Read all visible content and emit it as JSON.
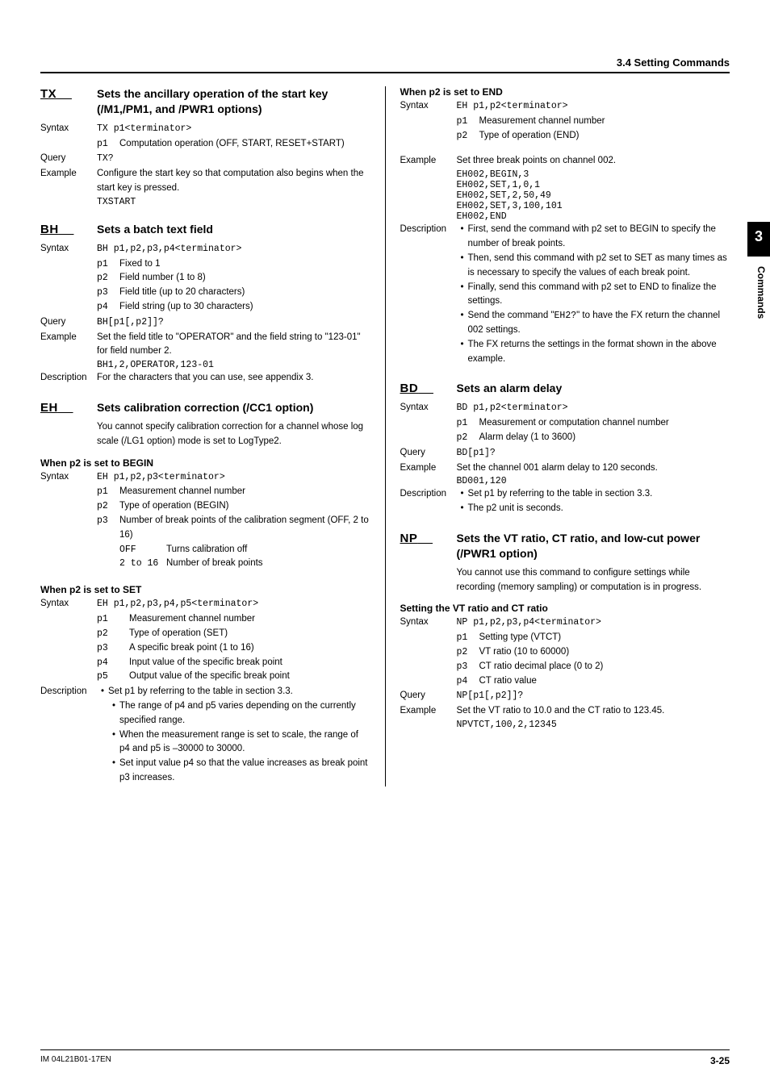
{
  "section_header": "3.4  Setting Commands",
  "side_tab": "3",
  "side_label": "Commands",
  "footer_left": "IM 04L21B01-17EN",
  "footer_right": "3-25",
  "left": {
    "tx": {
      "code": "TX",
      "title": "Sets the ancillary operation of the start key (/M1,/PM1, and /PWR1 options)",
      "syntax_label": "Syntax",
      "syntax": "TX p1<terminator>",
      "p1": "Computation operation (OFF, START, RESET+START)",
      "query_label": "Query",
      "query": "TX?",
      "example_label": "Example",
      "example_text": "Configure the start key so that computation also begins when the start key is pressed.",
      "example_code": "TXSTART"
    },
    "bh": {
      "code": "BH",
      "title": "Sets a batch text field",
      "syntax_label": "Syntax",
      "syntax": "BH p1,p2,p3,p4<terminator>",
      "p1": "Fixed to 1",
      "p2": "Field number (1 to 8)",
      "p3": "Field title (up to 20 characters)",
      "p4": "Field string (up to 30 characters)",
      "query_label": "Query",
      "query": "BH[p1[,p2]]?",
      "example_label": "Example",
      "example_text": "Set the field title to \"OPERATOR\" and the field string to \"123-01\" for field number 2.",
      "example_code": "BH1,2,OPERATOR,123-01",
      "desc_label": "Description",
      "desc": "For the characters that you can use, see appendix 3."
    },
    "eh": {
      "code": "EH",
      "title": "Sets calibration correction (/CC1 option)",
      "intro": "You cannot specify calibration correction for a channel whose log scale (/LG1 option) mode is set to LogType2.",
      "begin_header": "When p2 is set to BEGIN",
      "begin_syntax_label": "Syntax",
      "begin_syntax": "EH p1,p2,p3<terminator>",
      "begin_p1": "Measurement channel number",
      "begin_p2": "Type of operation (BEGIN)",
      "begin_p3": "Number of break points of the calibration segment (OFF, 2 to 16)",
      "begin_opt_off_key": "OFF",
      "begin_opt_off": "Turns calibration off",
      "begin_opt_range_key": "2 to 16",
      "begin_opt_range": "Number of break points",
      "set_header": "When p2 is set to SET",
      "set_syntax_label": "Syntax",
      "set_syntax": "EH p1,p2,p3,p4,p5<terminator>",
      "set_p1": "Measurement channel number",
      "set_p2": "Type of operation (SET)",
      "set_p3": "A specific break point (1 to 16)",
      "set_p4": "Input value of the specific break point",
      "set_p5": "Output value of the specific break point",
      "set_desc_label": "Description",
      "set_b0": "Set p1 by referring to the table in section 3.3.",
      "set_b1": "The range of p4 and p5 varies depending on the currently specified range.",
      "set_b2": "When the measurement range is set to scale, the range of p4 and p5 is –30000 to 30000.",
      "set_b3": "Set input value p4 so that the value increases as break point p3 increases."
    }
  },
  "right": {
    "eh_end": {
      "header": "When p2 is set to END",
      "syntax_label": "Syntax",
      "syntax": "EH p1,p2<terminator>",
      "p1": "Measurement channel number",
      "p2": "Type of operation (END)",
      "example_label": "Example",
      "example_text": "Set three break points on channel 002.",
      "c1": "EH002,BEGIN,3",
      "c2": "EH002,SET,1,0,1",
      "c3": "EH002,SET,2,50,49",
      "c4": "EH002,SET,3,100,101",
      "c5": "EH002,END",
      "desc_label": "Description",
      "b0": "First, send the command with p2 set to BEGIN to specify the number of break points.",
      "b1": "Then, send this command with p2 set to SET as many times as is necessary to specify the values of each break point.",
      "b2": "Finally, send this command with p2 set to END to finalize the settings.",
      "b3a": "Send the command \"",
      "b3code": "EH2?",
      "b3b": "\" to have the FX return the channel 002 settings.",
      "b4": "The FX returns the settings in the format shown in the above example."
    },
    "bd": {
      "code": "BD",
      "title": "Sets an alarm delay",
      "syntax_label": "Syntax",
      "syntax": "BD p1,p2<terminator>",
      "p1": "Measurement or computation channel number",
      "p2": "Alarm delay (1 to 3600)",
      "query_label": "Query",
      "query": "BD[p1]?",
      "example_label": "Example",
      "example_text": "Set the channel 001 alarm delay to 120 seconds.",
      "example_code": "BD001,120",
      "desc_label": "Description",
      "b0": "Set p1 by referring to the table in section 3.3.",
      "b1": "The p2 unit is seconds."
    },
    "np": {
      "code": "NP",
      "title": "Sets the VT ratio, CT ratio, and low-cut power (/PWR1 option)",
      "intro": "You cannot use this command to configure settings while recording (memory sampling) or computation is in progress.",
      "sub": "Setting the VT ratio and CT ratio",
      "syntax_label": "Syntax",
      "syntax": "NP p1,p2,p3,p4<terminator>",
      "p1": "Setting type (VTCT)",
      "p2": "VT ratio (10 to 60000)",
      "p3": "CT ratio decimal place (0 to 2)",
      "p4": "CT ratio value",
      "query_label": "Query",
      "query": "NP[p1[,p2]]?",
      "example_label": "Example",
      "example_text": "Set the VT ratio to 10.0 and the CT ratio to 123.45.",
      "example_code": "NPVTCT,100,2,12345"
    }
  }
}
